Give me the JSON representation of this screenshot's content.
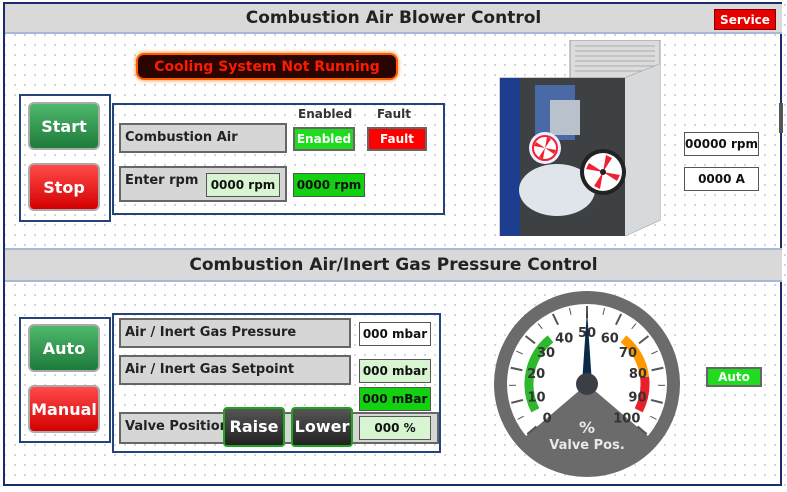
{
  "section1": {
    "title": "Combustion Air Blower Control",
    "service_label": "Service"
  },
  "alarm_text": "Cooling System Not Running",
  "blower": {
    "start_label": "Start",
    "stop_label": "Stop",
    "col_enabled": "Enabled",
    "col_fault": "Fault",
    "combustion_air_label": "Combustion Air",
    "enabled_indicator": "Enabled",
    "fault_indicator": "Fault",
    "enter_rpm_label": "Enter rpm",
    "rpm_input": "0000 rpm",
    "rpm_readout": "0000 rpm",
    "rpm_display": "00000 rpm",
    "amp_display": "0000 A"
  },
  "section2": {
    "title": "Combustion Air/Inert Gas Pressure Control"
  },
  "pressure": {
    "auto_label": "Auto",
    "manual_label": "Manual",
    "pressure_label": "Air / Inert Gas Pressure",
    "pressure_value": "000 mbar",
    "setpoint_label": "Air / Inert Gas Setpoint",
    "setpoint_value": "000 mbar",
    "setpoint_readout": "000 mBar",
    "valve_label": "Valve Position",
    "raise_label": "Raise",
    "lower_label": "Lower",
    "valve_value": "000 %",
    "mode_indicator": "Auto"
  },
  "gauge": {
    "unit": "%",
    "caption": "Valve Pos.",
    "value": 50,
    "min": 0,
    "max": 100,
    "ticks": [
      "0",
      "10",
      "20",
      "30",
      "40",
      "50",
      "60",
      "70",
      "80",
      "90",
      "100"
    ],
    "colors": {
      "green": "#2db82d",
      "orange": "#ff9900",
      "red": "#e8202a",
      "needle": "#0b2a4a",
      "face": "#ffffff",
      "rim": "#6b6b6b"
    }
  },
  "colors": {
    "accent_blue": "#23437a",
    "alarm": "#ff1a00",
    "indicator_green": "#1fdc1f"
  }
}
